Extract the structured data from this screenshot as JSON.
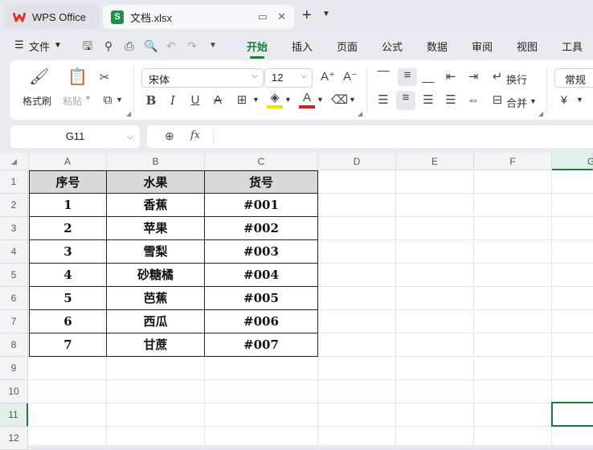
{
  "tabs": {
    "app": "WPS Office",
    "doc": "文档.xlsx"
  },
  "menu": {
    "file": "文件",
    "items": [
      "开始",
      "插入",
      "页面",
      "公式",
      "数据",
      "审阅",
      "视图",
      "工具"
    ]
  },
  "ribbon": {
    "format_painter": "格式刷",
    "paste": "粘贴",
    "font": "宋体",
    "size": "12",
    "wrap": "换行",
    "merge": "合并",
    "number_format": "常规",
    "currency": "¥"
  },
  "namebox": "G11",
  "fx": "fx",
  "columns": [
    "A",
    "B",
    "C",
    "D",
    "E",
    "F",
    "G"
  ],
  "rows": [
    "1",
    "2",
    "3",
    "4",
    "5",
    "6",
    "7",
    "8",
    "9",
    "10",
    "11",
    "12"
  ],
  "table": {
    "headers": [
      "序号",
      "水果",
      "货号"
    ],
    "rows": [
      [
        "1",
        "香蕉",
        "#001"
      ],
      [
        "2",
        "苹果",
        "#002"
      ],
      [
        "3",
        "雪梨",
        "#003"
      ],
      [
        "4",
        "砂糖橘",
        "#004"
      ],
      [
        "5",
        "芭蕉",
        "#005"
      ],
      [
        "6",
        "西瓜",
        "#006"
      ],
      [
        "7",
        "甘蔗",
        "#007"
      ]
    ]
  },
  "colors": {
    "accent": "#1a7f3c",
    "header_fill": "#d9d9d9",
    "selection": "#1f7a3a"
  }
}
